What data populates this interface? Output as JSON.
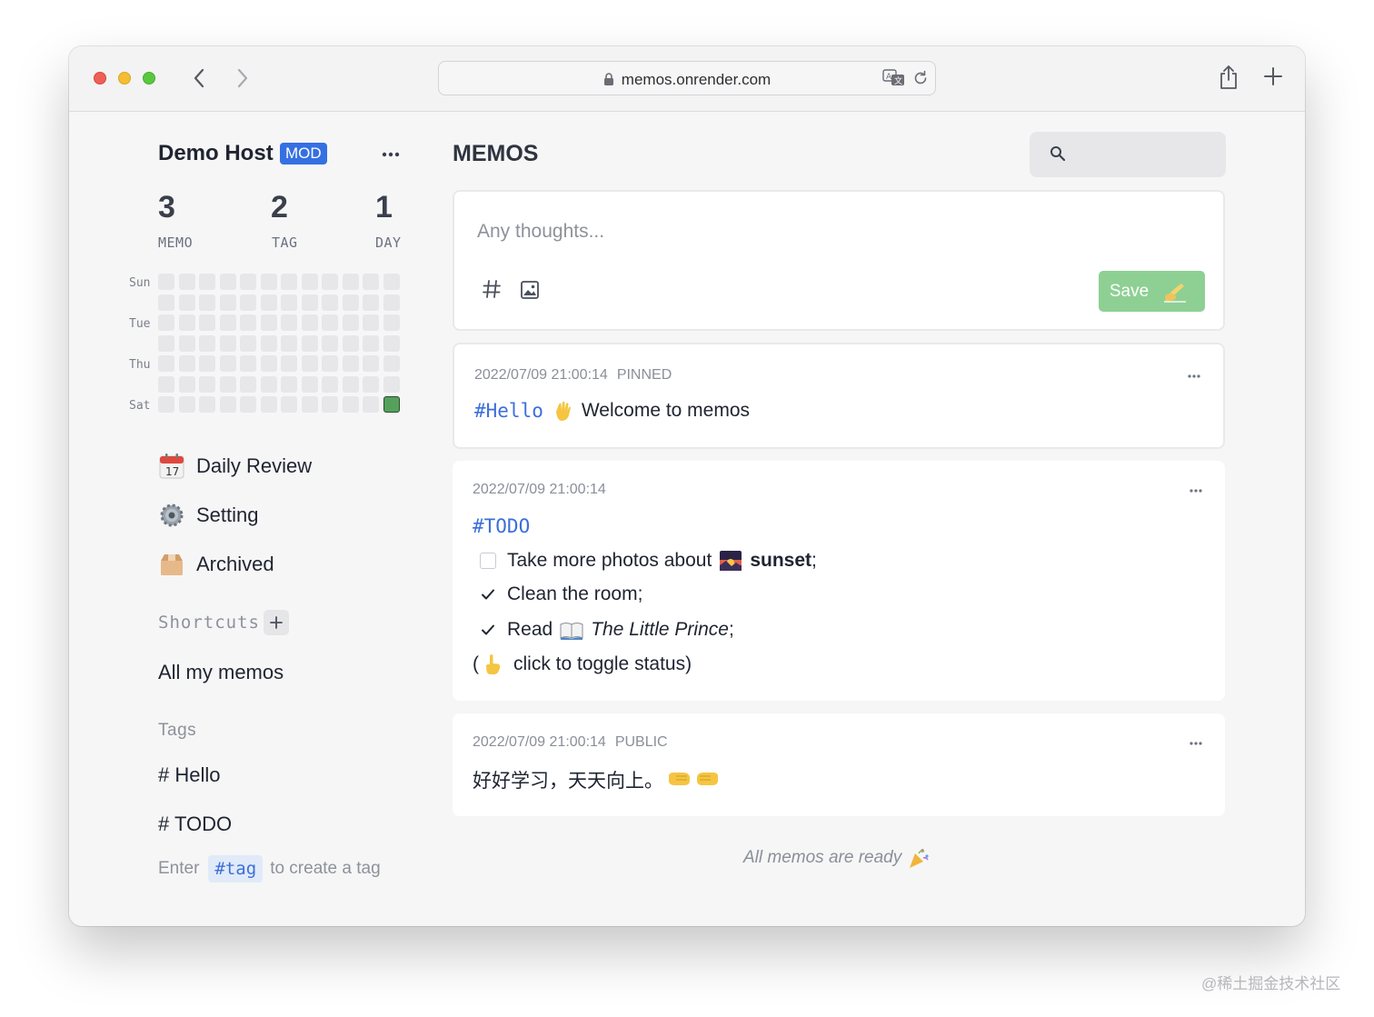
{
  "browser": {
    "url": "memos.onrender.com"
  },
  "sidebar": {
    "user_name": "Demo Host",
    "role_badge": "MOD",
    "stats": [
      {
        "value": "3",
        "label": "MEMO"
      },
      {
        "value": "2",
        "label": "TAG"
      },
      {
        "value": "1",
        "label": "DAY"
      }
    ],
    "heatmap": {
      "day_labels": [
        "Sun",
        "Tue",
        "Thu",
        "Sat"
      ],
      "active_cell": "last-column-Sat",
      "active_color": "#55a15c",
      "empty_color": "#e7e7e9"
    },
    "nav": [
      {
        "label": "Daily Review",
        "icon": "calendar-icon"
      },
      {
        "label": "Setting",
        "icon": "gear-icon"
      },
      {
        "label": "Archived",
        "icon": "box-icon"
      }
    ],
    "shortcuts_title": "Shortcuts",
    "shortcuts": [
      "All my memos"
    ],
    "tags_title": "Tags",
    "tags": [
      "# Hello",
      "# TODO"
    ],
    "tag_hint": {
      "prefix": "Enter",
      "chip": "#tag",
      "suffix": "to create a tag"
    }
  },
  "main": {
    "title": "MEMOS",
    "editor": {
      "placeholder": "Any thoughts...",
      "save_label": "Save",
      "save_color": "#8ed093"
    },
    "memos": [
      {
        "timestamp": "2022/07/09 21:00:14",
        "visibility": "PINNED",
        "tag": "#Hello",
        "text": "Welcome to memos"
      },
      {
        "timestamp": "2022/07/09 21:00:14",
        "visibility": "",
        "tag": "#TODO",
        "todos": [
          {
            "checked": false,
            "pre": "Take more photos about",
            "bold": "sunset",
            "post": ";"
          },
          {
            "checked": true,
            "pre": "Clean the room;"
          },
          {
            "checked": true,
            "pre": "Read",
            "italic": "The Little Prince",
            "post": ";"
          }
        ],
        "note_open": "(",
        "note_text": "click to toggle status)"
      },
      {
        "timestamp": "2022/07/09 21:00:14",
        "visibility": "PUBLIC",
        "text": "好好学习，天天向上。"
      }
    ],
    "footer_text": "All memos are ready"
  },
  "watermark": "@稀土掘金技术社区"
}
